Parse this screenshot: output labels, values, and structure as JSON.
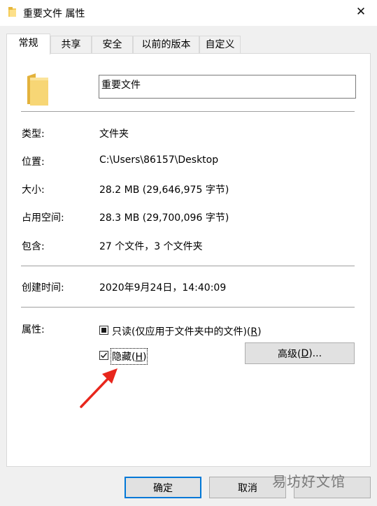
{
  "window": {
    "title": "重要文件 属性",
    "close_glyph": "✕"
  },
  "tabs": [
    {
      "label": "常规",
      "active": true
    },
    {
      "label": "共享",
      "active": false
    },
    {
      "label": "安全",
      "active": false
    },
    {
      "label": "以前的版本",
      "active": false
    },
    {
      "label": "自定义",
      "active": false
    }
  ],
  "general": {
    "folder_name": "重要文件",
    "fields": {
      "type_label": "类型:",
      "type_value": "文件夹",
      "location_label": "位置:",
      "location_value": "C:\\Users\\86157\\Desktop",
      "size_label": "大小:",
      "size_value": "28.2 MB (29,646,975 字节)",
      "disk_label": "占用空间:",
      "disk_value": "28.3 MB (29,700,096 字节)",
      "contains_label": "包含:",
      "contains_value": "27 个文件，3 个文件夹",
      "created_label": "创建时间:",
      "created_value": "2020年9月24日，14:40:09"
    },
    "attributes": {
      "label": "属性:",
      "readonly_label": "只读(仅应用于文件夹中的文件)(",
      "readonly_key": "R",
      "readonly_state": "indeterminate",
      "hidden_label": "隐藏(",
      "hidden_key": "H",
      "hidden_checked": true,
      "advanced_label": "高级(",
      "advanced_key": "D",
      "advanced_suffix": ")..."
    }
  },
  "footer": {
    "ok": "确定",
    "cancel": "取消"
  },
  "annotation": {
    "arrow_color": "#e8261c"
  },
  "watermark": "易坊好文馆"
}
